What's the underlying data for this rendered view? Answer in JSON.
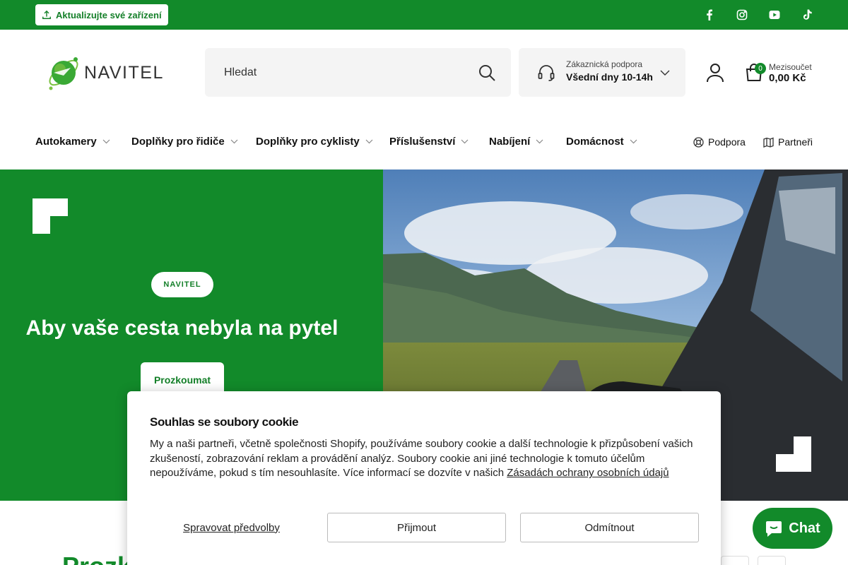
{
  "topbar": {
    "update_label": "Aktualizujte své zařízení",
    "socials": [
      "facebook-icon",
      "instagram-icon",
      "youtube-icon",
      "tiktok-icon"
    ]
  },
  "header": {
    "logo_text": "NAVITEL",
    "search_placeholder": "Hledat",
    "support_small": "Zákaznická podpora",
    "support_hours": "Všední dny 10-14h",
    "cart_count": "0",
    "subtotal_label": "Mezisoučet",
    "subtotal_value": "0,00 Kč"
  },
  "nav": {
    "items": [
      {
        "label": "Autokamery"
      },
      {
        "label": "Doplňky pro řidiče"
      },
      {
        "label": "Doplňky pro cyklisty"
      },
      {
        "label": "Příslušenství"
      },
      {
        "label": "Nabíjení"
      },
      {
        "label": "Domácnost"
      }
    ],
    "support": "Podpora",
    "partners": "Partneři"
  },
  "hero": {
    "brand": "NAVITEL",
    "title": "Aby vaše cesta nebyla na pytel",
    "cta": "Prozkoumat"
  },
  "below": {
    "heading_peek": "Prozk"
  },
  "cookie": {
    "title": "Souhlas se soubory cookie",
    "text": "My a naši partneři, včetně společnosti Shopify, používáme soubory cookie a další technologie k přizpůsobení vašich zkušeností, zobrazování reklam a provádění analýz. Soubory cookie ani jiné technologie k tomuto účelům nepoužíváme, pokud s tím nesouhlasíte. Více informací se dozvíte v našich ",
    "link": "Zásadách ochrany osobních údajů",
    "manage": "Spravovat předvolby",
    "accept": "Přijmout",
    "decline": "Odmítnout"
  },
  "chat": {
    "label": "Chat"
  },
  "colors": {
    "brand_green": "#128a2a",
    "text_dark": "#111111"
  }
}
